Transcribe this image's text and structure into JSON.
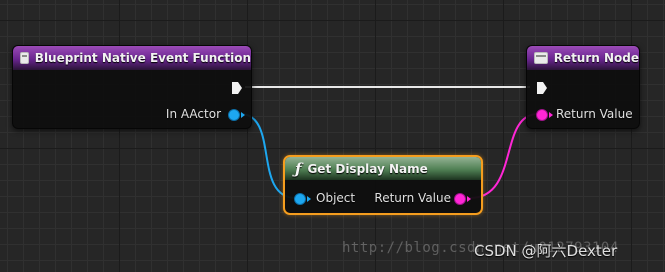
{
  "nodes": {
    "event": {
      "title": "Blueprint Native Event Function",
      "pin_out": "In AActor"
    },
    "return": {
      "title": "Return Node",
      "pin_in": "Return Value"
    },
    "pure": {
      "title": "Get Display Name",
      "pin_in": "Object",
      "pin_out": "Return Value"
    }
  },
  "colors": {
    "object_pin": "#1da7f0",
    "string_pin": "#ff26d6",
    "exec_wire": "#e8e8e8",
    "event_header": "#6a2590",
    "pure_header": "#4f7f53",
    "selection": "#f59d1e"
  },
  "watermark": {
    "url": "http://blog.csdn.net/u012793104",
    "brand": "CSDN @阿六Dexter"
  }
}
